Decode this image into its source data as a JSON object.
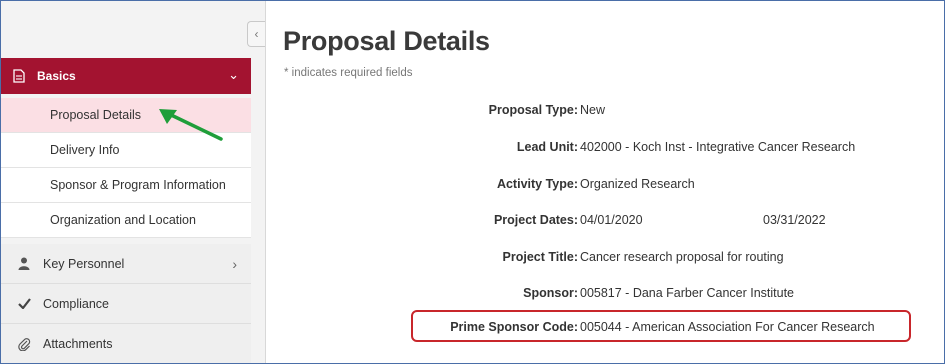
{
  "sidebar": {
    "collapse_glyph": "‹",
    "section": {
      "label": "Basics",
      "icon": "document-icon",
      "chevron": "⌄",
      "color": "#a31330"
    },
    "subitems": [
      {
        "label": "Proposal Details",
        "active": true
      },
      {
        "label": "Delivery Info"
      },
      {
        "label": "Sponsor & Program Information"
      },
      {
        "label": "Organization and Location"
      }
    ],
    "items": [
      {
        "label": "Key Personnel",
        "icon": "person-icon",
        "chevron": "›"
      },
      {
        "label": "Compliance",
        "icon": "checkmark-icon"
      },
      {
        "label": "Attachments",
        "icon": "paperclip-icon"
      }
    ]
  },
  "main": {
    "title": "Proposal Details",
    "required_note": "* indicates required fields",
    "fields": [
      {
        "label": "Proposal Type:",
        "value": "New"
      },
      {
        "label": "Lead Unit:",
        "value": "402000 - Koch Inst - Integrative Cancer Research"
      },
      {
        "label": "Activity Type:",
        "value": "Organized Research"
      },
      {
        "label": "Project Dates:",
        "value": "04/01/2020",
        "value2": "03/31/2022"
      },
      {
        "label": "Project Title:",
        "value": "Cancer research proposal for routing"
      },
      {
        "label": "Sponsor:",
        "value": "005817  -  Dana Farber Cancer Institute"
      },
      {
        "label": "Prime Sponsor Code:",
        "value": "005044  -  American Association For Cancer Research"
      }
    ]
  },
  "annotations": {
    "arrow_color": "#1f9e3a",
    "box_color": "#c8262b"
  }
}
